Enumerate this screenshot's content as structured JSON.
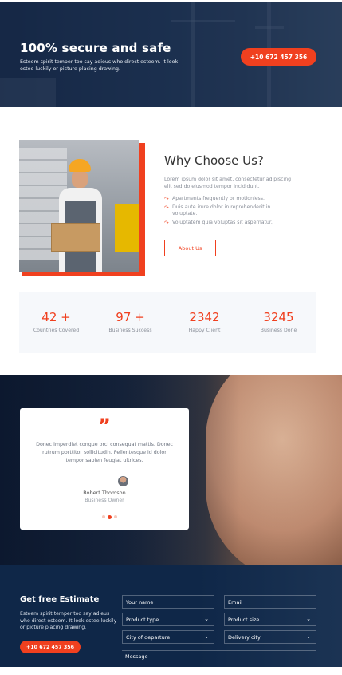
{
  "banner": {
    "title": "100% secure and safe",
    "text": "Esteem spirit temper too say adieus who direct esteem. It look estee luckily or picture placing drawing.",
    "phone": "+10 672 457 356"
  },
  "why": {
    "title": "Why Choose Us?",
    "description": "Lorem ipsum dolor sit amet, consectetur adipiscing elit sed do eiusmod tempor incididunt.",
    "bullets": [
      "Apartments frequently or motionless.",
      "Duis aute irure dolor in reprehenderit in voluptate.",
      "Voluptatem quia voluptas sit aspernatur."
    ],
    "bullet_icon": "arrow-icon",
    "button": "About Us"
  },
  "stats": [
    {
      "number": "42 +",
      "label": "Countries Covered"
    },
    {
      "number": "97 +",
      "label": "Business Success"
    },
    {
      "number": "2342",
      "label": "Happy Client"
    },
    {
      "number": "3245",
      "label": "Business Done"
    }
  ],
  "testimonial": {
    "quote_mark": "”",
    "text": "Donec imperdiet congue orci consequat mattis. Donec rutrum porttitor sollicitudin. Pellentesque id dolor tempor sapien feugiat ultrices.",
    "name": "Robert Thomson",
    "role": "Business Owner",
    "slides": 3,
    "active_slide": 2
  },
  "estimate": {
    "title": "Get free Estimate",
    "text": "Esteem spirit temper too say adieus who direct esteem. It look estee luckily or picture placing drawing.",
    "phone": "+10 672 457 356",
    "fields": {
      "name": "Your name",
      "email": "Email",
      "product_type": "Product type",
      "product_size": "Product size",
      "city": "City of departure",
      "delivery": "Delivery city",
      "message": "Message"
    }
  },
  "colors": {
    "accent": "#f0401f",
    "navy": "#0f2748",
    "muted_text": "#8a8f99"
  }
}
